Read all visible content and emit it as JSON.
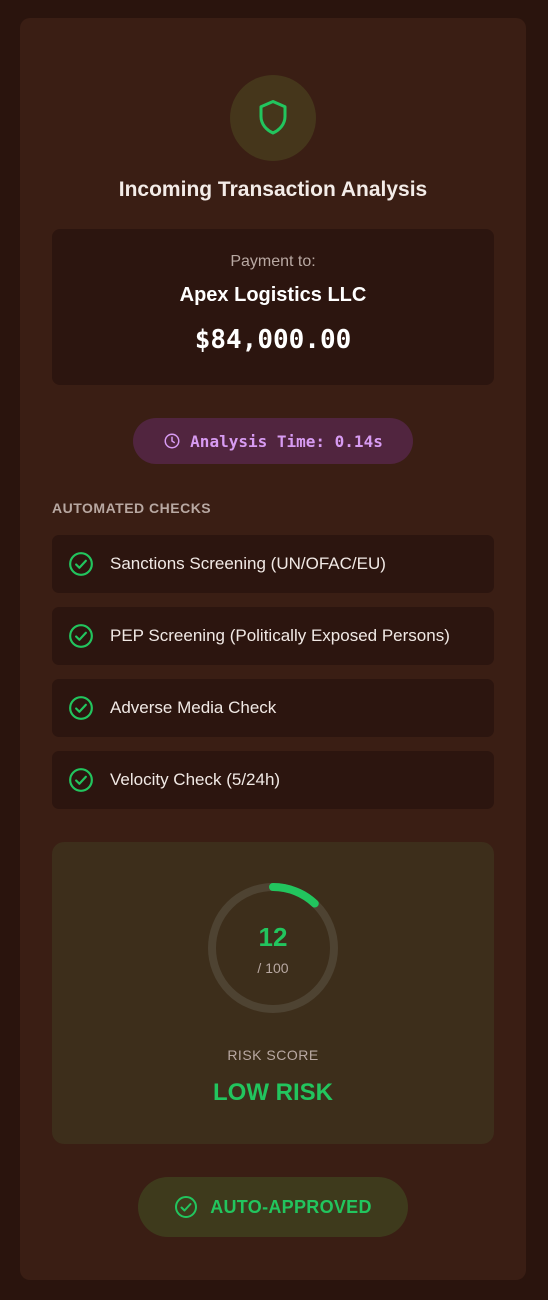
{
  "header": {
    "icon": "shield-icon",
    "title": "Incoming Transaction Analysis"
  },
  "payment": {
    "label": "Payment to:",
    "payee": "Apex Logistics LLC",
    "amount": "$84,000.00"
  },
  "analysis": {
    "icon": "clock-icon",
    "time_label": "Analysis Time: 0.14s"
  },
  "checks": {
    "title": "AUTOMATED CHECKS",
    "items": [
      {
        "label": "Sanctions Screening (UN/OFAC/EU)",
        "icon": "check-circle-icon",
        "status": "passed"
      },
      {
        "label": "PEP Screening (Politically Exposed Persons)",
        "icon": "check-circle-icon",
        "status": "passed"
      },
      {
        "label": "Adverse Media Check",
        "icon": "check-circle-icon",
        "status": "passed"
      },
      {
        "label": "Velocity Check (5/24h)",
        "icon": "check-circle-icon",
        "status": "passed"
      }
    ]
  },
  "risk": {
    "score": "12",
    "max": "/ 100",
    "score_value": 12,
    "score_max": 100,
    "label": "RISK SCORE",
    "level": "LOW RISK"
  },
  "decision": {
    "icon": "check-circle-icon",
    "label": "AUTO-APPROVED"
  },
  "colors": {
    "accent_green": "#22c55e",
    "analysis_purple": "#d79bf2",
    "background": "#2a140d",
    "card": "#3a1e14"
  }
}
